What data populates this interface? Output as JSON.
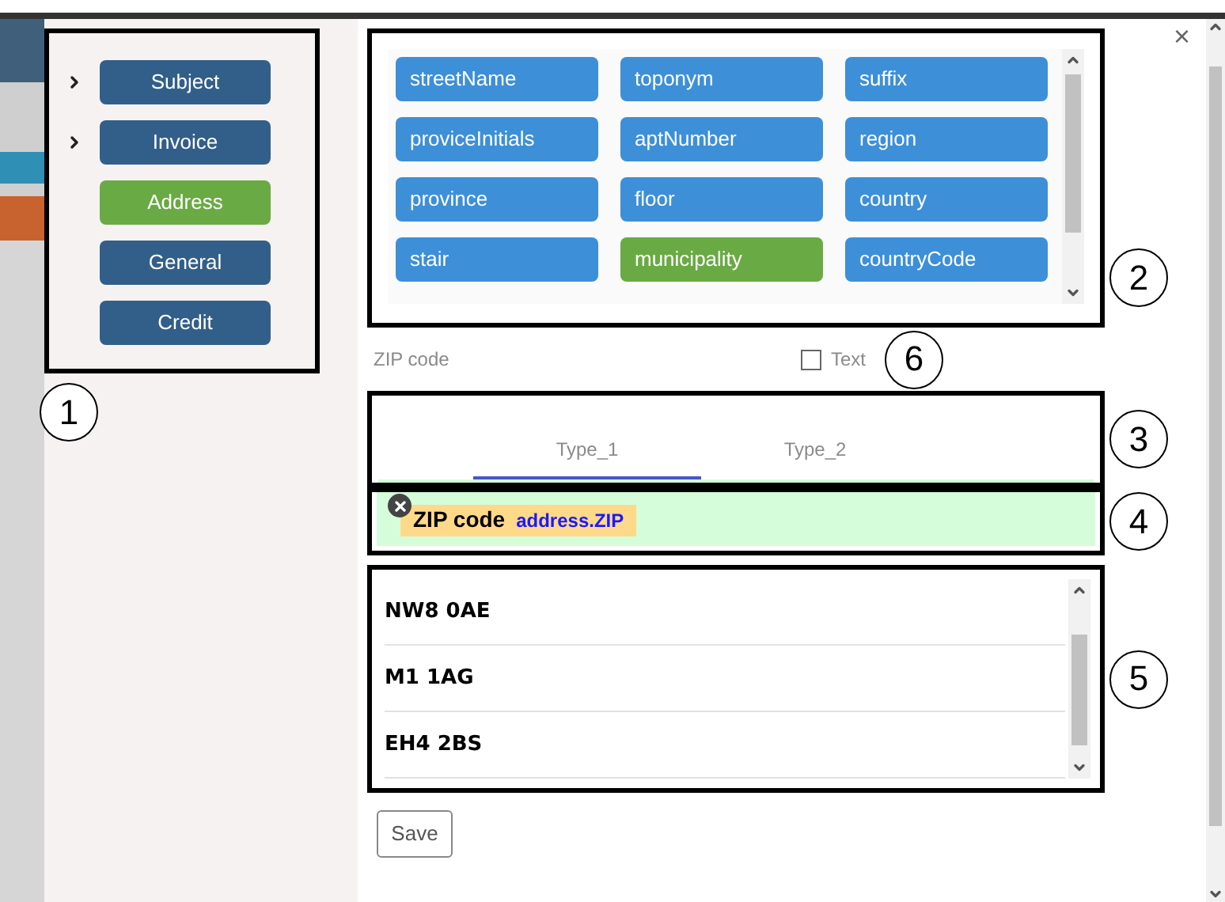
{
  "sidebar": {
    "items": [
      {
        "label": "Subject",
        "has_children": true,
        "selected": false
      },
      {
        "label": "Invoice",
        "has_children": true,
        "selected": false
      },
      {
        "label": "Address",
        "has_children": false,
        "selected": true
      },
      {
        "label": "General",
        "has_children": false,
        "selected": false
      },
      {
        "label": "Credit",
        "has_children": false,
        "selected": false
      }
    ]
  },
  "fields": [
    {
      "label": "streetName",
      "selected": false
    },
    {
      "label": "toponym",
      "selected": false
    },
    {
      "label": "suffix",
      "selected": false
    },
    {
      "label": "proviceInitials",
      "selected": false
    },
    {
      "label": "aptNumber",
      "selected": false
    },
    {
      "label": "region",
      "selected": false
    },
    {
      "label": "province",
      "selected": false
    },
    {
      "label": "floor",
      "selected": false
    },
    {
      "label": "country",
      "selected": false
    },
    {
      "label": "stair",
      "selected": false
    },
    {
      "label": "municipality",
      "selected": true
    },
    {
      "label": "countryCode",
      "selected": false
    }
  ],
  "field_label": "ZIP code",
  "text_option": {
    "label": "Text",
    "checked": false
  },
  "tabs": [
    {
      "label": "Type_1",
      "selected": true
    },
    {
      "label": "Type_2",
      "selected": false
    }
  ],
  "mapping": {
    "label": "ZIP code",
    "path": "address.ZIP"
  },
  "values": [
    "NW8 0AE",
    "M1 1AG",
    "EH4 2BS"
  ],
  "save": "Save",
  "close": "×",
  "callouts": [
    "1",
    "2",
    "3",
    "4",
    "5",
    "6"
  ]
}
